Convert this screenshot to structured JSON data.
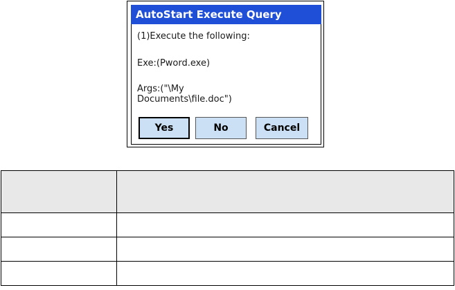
{
  "dialog": {
    "title": "AutoStart Execute Query",
    "lines": [
      "(1)Execute the following:",
      "Exe:(Pword.exe)",
      "Args:(\"\\My",
      "Documents\\file.doc\")"
    ],
    "buttons": {
      "yes": "Yes",
      "no": "No",
      "cancel": "Cancel"
    }
  },
  "table": {
    "header": [
      "",
      ""
    ],
    "rows": [
      [
        "",
        ""
      ],
      [
        "",
        ""
      ],
      [
        "",
        ""
      ]
    ]
  }
}
